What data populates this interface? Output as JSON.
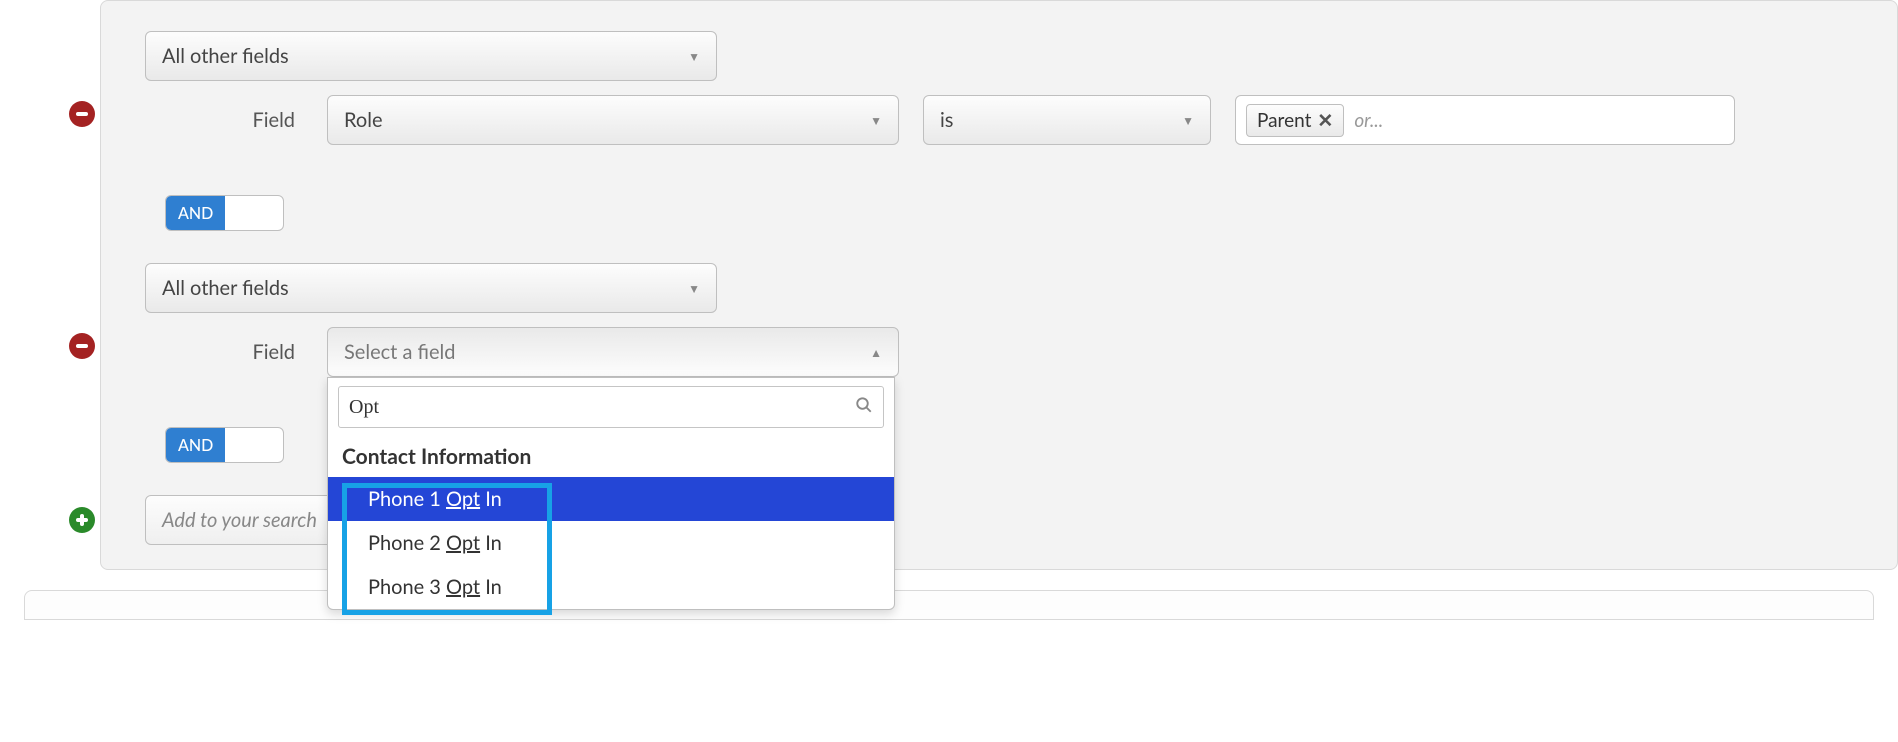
{
  "block1": {
    "category_select": "All other fields",
    "field_label": "Field",
    "field_value": "Role",
    "operator": "is",
    "tag": "Parent",
    "tag_placeholder": "or..."
  },
  "and_label": "AND",
  "block2": {
    "category_select": "All other fields",
    "field_label": "Field",
    "field_placeholder": "Select a field",
    "search_value": "Opt",
    "group_header": "Contact Information",
    "options": [
      {
        "prefix": "Phone 1 ",
        "match": "Opt",
        "suffix": " In"
      },
      {
        "prefix": "Phone 2 ",
        "match": "Opt",
        "suffix": " In"
      },
      {
        "prefix": "Phone 3 ",
        "match": "Opt",
        "suffix": " In"
      }
    ]
  },
  "add_placeholder": "Add to your search"
}
